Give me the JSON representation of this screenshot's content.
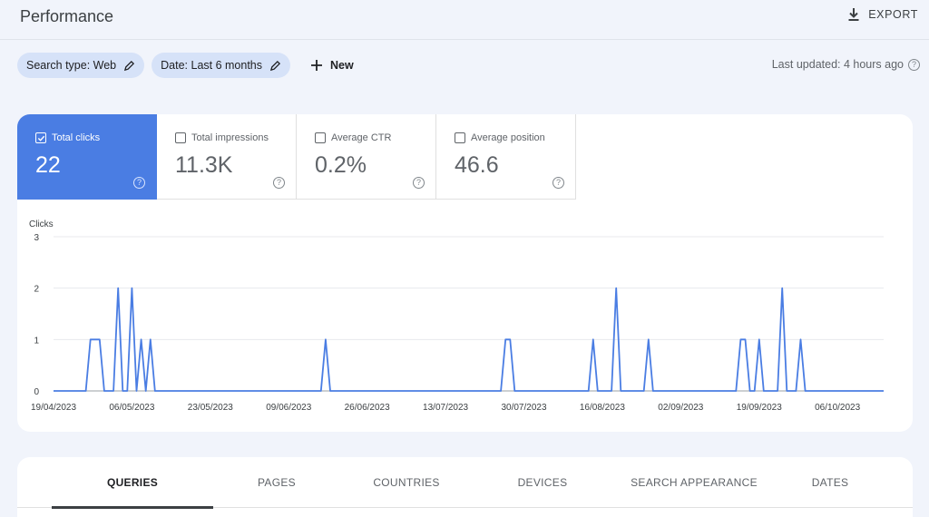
{
  "header": {
    "title": "Performance",
    "export_label": "EXPORT"
  },
  "filters": {
    "chips": [
      {
        "label": "Search type: Web"
      },
      {
        "label": "Date: Last 6 months"
      }
    ],
    "new_label": "New"
  },
  "last_updated": "Last updated: 4 hours ago",
  "metrics": [
    {
      "label": "Total clicks",
      "value": "22",
      "active": true
    },
    {
      "label": "Total impressions",
      "value": "11.3K",
      "active": false
    },
    {
      "label": "Average CTR",
      "value": "0.2%",
      "active": false
    },
    {
      "label": "Average position",
      "value": "46.6",
      "active": false
    }
  ],
  "colors": {
    "accent": "#4a7de3",
    "line": "#4a7de3"
  },
  "chart_data": {
    "type": "line",
    "ylabel": "Clicks",
    "ylim": [
      0,
      3
    ],
    "yticks": [
      "0",
      "1",
      "2",
      "3"
    ],
    "xtick_labels": [
      "19/04/2023",
      "06/05/2023",
      "23/05/2023",
      "09/06/2023",
      "26/06/2023",
      "13/07/2023",
      "30/07/2023",
      "16/08/2023",
      "02/09/2023",
      "19/09/2023",
      "06/10/2023"
    ],
    "x_start": "2023-04-19",
    "x_end": "2023-10-16",
    "series": [
      {
        "values": [
          {
            "x": "2023-04-19",
            "y": 0
          },
          {
            "x": "2023-04-20",
            "y": 0
          },
          {
            "x": "2023-04-21",
            "y": 0
          },
          {
            "x": "2023-04-22",
            "y": 0
          },
          {
            "x": "2023-04-23",
            "y": 0
          },
          {
            "x": "2023-04-24",
            "y": 0
          },
          {
            "x": "2023-04-25",
            "y": 0
          },
          {
            "x": "2023-04-26",
            "y": 0
          },
          {
            "x": "2023-04-27",
            "y": 1
          },
          {
            "x": "2023-04-28",
            "y": 1
          },
          {
            "x": "2023-04-29",
            "y": 1
          },
          {
            "x": "2023-04-30",
            "y": 0
          },
          {
            "x": "2023-05-01",
            "y": 0
          },
          {
            "x": "2023-05-02",
            "y": 0
          },
          {
            "x": "2023-05-03",
            "y": 2
          },
          {
            "x": "2023-05-04",
            "y": 0
          },
          {
            "x": "2023-05-05",
            "y": 0
          },
          {
            "x": "2023-05-06",
            "y": 2
          },
          {
            "x": "2023-05-07",
            "y": 0
          },
          {
            "x": "2023-05-08",
            "y": 1
          },
          {
            "x": "2023-05-09",
            "y": 0
          },
          {
            "x": "2023-05-10",
            "y": 1
          },
          {
            "x": "2023-05-11",
            "y": 0
          },
          {
            "x": "2023-05-12",
            "y": 0
          },
          {
            "x": "2023-06-13",
            "y": 0
          },
          {
            "x": "2023-06-14",
            "y": 0
          },
          {
            "x": "2023-06-16",
            "y": 0
          },
          {
            "x": "2023-06-17",
            "y": 1
          },
          {
            "x": "2023-06-18",
            "y": 0
          },
          {
            "x": "2023-06-19",
            "y": 0
          },
          {
            "x": "2023-07-25",
            "y": 0
          },
          {
            "x": "2023-07-26",
            "y": 1
          },
          {
            "x": "2023-07-27",
            "y": 1
          },
          {
            "x": "2023-07-28",
            "y": 0
          },
          {
            "x": "2023-08-12",
            "y": 0
          },
          {
            "x": "2023-08-13",
            "y": 0
          },
          {
            "x": "2023-08-14",
            "y": 1
          },
          {
            "x": "2023-08-15",
            "y": 0
          },
          {
            "x": "2023-08-17",
            "y": 0
          },
          {
            "x": "2023-08-18",
            "y": 0
          },
          {
            "x": "2023-08-19",
            "y": 2
          },
          {
            "x": "2023-08-20",
            "y": 0
          },
          {
            "x": "2023-08-24",
            "y": 0
          },
          {
            "x": "2023-08-25",
            "y": 0
          },
          {
            "x": "2023-08-26",
            "y": 1
          },
          {
            "x": "2023-08-27",
            "y": 0
          },
          {
            "x": "2023-09-13",
            "y": 0
          },
          {
            "x": "2023-09-14",
            "y": 0
          },
          {
            "x": "2023-09-15",
            "y": 1
          },
          {
            "x": "2023-09-16",
            "y": 1
          },
          {
            "x": "2023-09-17",
            "y": 0
          },
          {
            "x": "2023-09-18",
            "y": 0
          },
          {
            "x": "2023-09-19",
            "y": 1
          },
          {
            "x": "2023-09-20",
            "y": 0
          },
          {
            "x": "2023-09-22",
            "y": 0
          },
          {
            "x": "2023-09-23",
            "y": 0
          },
          {
            "x": "2023-09-24",
            "y": 2
          },
          {
            "x": "2023-09-25",
            "y": 0
          },
          {
            "x": "2023-09-26",
            "y": 0
          },
          {
            "x": "2023-09-27",
            "y": 0
          },
          {
            "x": "2023-09-28",
            "y": 1
          },
          {
            "x": "2023-09-29",
            "y": 0
          },
          {
            "x": "2023-10-16",
            "y": 0
          }
        ]
      }
    ]
  },
  "tabs": [
    {
      "label": "QUERIES",
      "active": true
    },
    {
      "label": "PAGES",
      "active": false
    },
    {
      "label": "COUNTRIES",
      "active": false
    },
    {
      "label": "DEVICES",
      "active": false
    },
    {
      "label": "SEARCH APPEARANCE",
      "active": false
    },
    {
      "label": "DATES",
      "active": false
    }
  ]
}
